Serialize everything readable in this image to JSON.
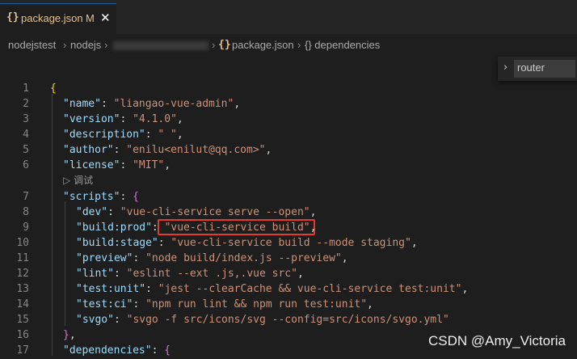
{
  "tab": {
    "icon": "{}",
    "title": "package.json",
    "modified": "M",
    "close": "✕"
  },
  "breadcrumb": {
    "items": [
      "nodejstest",
      "nodejs",
      "package.json",
      "{} dependencies"
    ],
    "json_icon": "{}",
    "sep": "›"
  },
  "outline": {
    "filter": "router",
    "chevron": "›"
  },
  "codelens": {
    "icon": "▷",
    "label": "调试"
  },
  "lines": [
    {
      "n": "1",
      "indent": 0,
      "parts": [
        [
          "b",
          "{"
        ]
      ]
    },
    {
      "n": "2",
      "indent": 1,
      "parts": [
        [
          "k",
          "\"name\""
        ],
        [
          "p",
          ": "
        ],
        [
          "s",
          "\"liangao-vue-admin\""
        ],
        [
          "p",
          ","
        ]
      ]
    },
    {
      "n": "3",
      "indent": 1,
      "parts": [
        [
          "k",
          "\"version\""
        ],
        [
          "p",
          ": "
        ],
        [
          "s",
          "\"4.1.0\""
        ],
        [
          "p",
          ","
        ]
      ]
    },
    {
      "n": "4",
      "indent": 1,
      "parts": [
        [
          "k",
          "\"description\""
        ],
        [
          "p",
          ": "
        ],
        [
          "s",
          "\" \""
        ],
        [
          "p",
          ","
        ]
      ]
    },
    {
      "n": "5",
      "indent": 1,
      "parts": [
        [
          "k",
          "\"author\""
        ],
        [
          "p",
          ": "
        ],
        [
          "s",
          "\"enilu<enilut@qq.com>\""
        ],
        [
          "p",
          ","
        ]
      ]
    },
    {
      "n": "6",
      "indent": 1,
      "parts": [
        [
          "k",
          "\"license\""
        ],
        [
          "p",
          ": "
        ],
        [
          "s",
          "\"MIT\""
        ],
        [
          "p",
          ","
        ]
      ]
    },
    {
      "n": "7",
      "indent": 1,
      "parts": [
        [
          "k",
          "\"scripts\""
        ],
        [
          "p",
          ": "
        ],
        [
          "b2",
          "{"
        ]
      ]
    },
    {
      "n": "8",
      "indent": 2,
      "parts": [
        [
          "k",
          "\"dev\""
        ],
        [
          "p",
          ": "
        ],
        [
          "s",
          "\"vue-cli-service serve --open\""
        ],
        [
          "p",
          ","
        ]
      ]
    },
    {
      "n": "9",
      "indent": 2,
      "parts": [
        [
          "k",
          "\"build:prod\""
        ],
        [
          "p",
          ": "
        ],
        [
          "s",
          "\"vue-cli-service build\""
        ],
        [
          "p",
          ","
        ]
      ]
    },
    {
      "n": "10",
      "indent": 2,
      "parts": [
        [
          "k",
          "\"build:stage\""
        ],
        [
          "p",
          ": "
        ],
        [
          "s",
          "\"vue-cli-service build --mode staging\""
        ],
        [
          "p",
          ","
        ]
      ]
    },
    {
      "n": "11",
      "indent": 2,
      "parts": [
        [
          "k",
          "\"preview\""
        ],
        [
          "p",
          ": "
        ],
        [
          "s",
          "\"node build/index.js --preview\""
        ],
        [
          "p",
          ","
        ]
      ]
    },
    {
      "n": "12",
      "indent": 2,
      "parts": [
        [
          "k",
          "\"lint\""
        ],
        [
          "p",
          ": "
        ],
        [
          "s",
          "\"eslint --ext .js,.vue src\""
        ],
        [
          "p",
          ","
        ]
      ]
    },
    {
      "n": "13",
      "indent": 2,
      "parts": [
        [
          "k",
          "\"test:unit\""
        ],
        [
          "p",
          ": "
        ],
        [
          "s",
          "\"jest --clearCache && vue-cli-service test:unit\""
        ],
        [
          "p",
          ","
        ]
      ]
    },
    {
      "n": "14",
      "indent": 2,
      "parts": [
        [
          "k",
          "\"test:ci\""
        ],
        [
          "p",
          ": "
        ],
        [
          "s",
          "\"npm run lint && npm run test:unit\""
        ],
        [
          "p",
          ","
        ]
      ]
    },
    {
      "n": "15",
      "indent": 2,
      "parts": [
        [
          "k",
          "\"svgo\""
        ],
        [
          "p",
          ": "
        ],
        [
          "s",
          "\"svgo -f src/icons/svg --config=src/icons/svgo.yml\""
        ]
      ]
    },
    {
      "n": "16",
      "indent": 1,
      "parts": [
        [
          "b2",
          "}"
        ],
        [
          "p",
          ","
        ]
      ]
    },
    {
      "n": "17",
      "indent": 1,
      "parts": [
        [
          "k",
          "\"dependencies\""
        ],
        [
          "p",
          ": "
        ],
        [
          "b2",
          "{"
        ]
      ]
    }
  ],
  "watermark": "CSDN @Amy_Victoria",
  "colors": {
    "accent": "#e03c31",
    "string": "#ce9178",
    "key": "#9cdcfe"
  }
}
